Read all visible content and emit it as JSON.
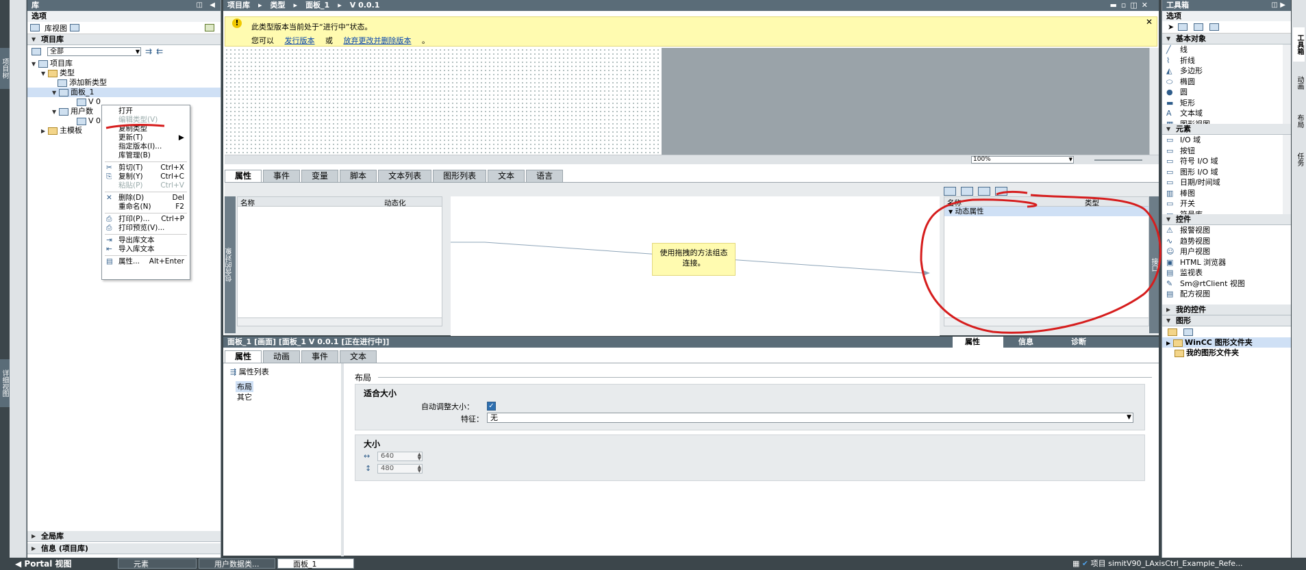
{
  "window": {
    "left_strip_top": "项目树",
    "left_strip_bottom": "详细视图"
  },
  "library": {
    "title": "库",
    "options_label": "选项",
    "lib_view_btn": "库视图",
    "project_library": "项目库",
    "filter": "全部",
    "tree": [
      "项目库",
      "类型",
      "添加新类型",
      "面板_1",
      "V 0",
      "用户数",
      "V 0",
      "主模板"
    ],
    "global_library": "全局库",
    "info": "信息 (项目库)"
  },
  "context_menu": [
    {
      "label": "打开",
      "shortcut": "",
      "icon": ""
    },
    {
      "label": "编辑类型(V)",
      "shortcut": "",
      "icon": "",
      "disabled": true
    },
    {
      "label": "复制类型",
      "shortcut": "",
      "icon": ""
    },
    {
      "label": "更新(T)",
      "shortcut": "▶",
      "icon": ""
    },
    {
      "label": "指定版本(I)...",
      "shortcut": "",
      "icon": ""
    },
    {
      "label": "库管理(B)",
      "shortcut": "",
      "icon": ""
    },
    {
      "sep": true
    },
    {
      "label": "剪切(T)",
      "shortcut": "Ctrl+X",
      "icon": "✂"
    },
    {
      "label": "复制(Y)",
      "shortcut": "Ctrl+C",
      "icon": "⎘"
    },
    {
      "label": "粘贴(P)",
      "shortcut": "Ctrl+V",
      "icon": "",
      "disabled": true
    },
    {
      "sep": true
    },
    {
      "label": "删除(D)",
      "shortcut": "Del",
      "icon": "✕"
    },
    {
      "label": "重命名(N)",
      "shortcut": "F2",
      "icon": ""
    },
    {
      "sep": true
    },
    {
      "label": "打印(P)...",
      "shortcut": "Ctrl+P",
      "icon": "⎙"
    },
    {
      "label": "打印预览(V)...",
      "shortcut": "",
      "icon": "⎙"
    },
    {
      "sep": true
    },
    {
      "label": "导出库文本",
      "shortcut": "",
      "icon": "⇥"
    },
    {
      "label": "导入库文本",
      "shortcut": "",
      "icon": "⇤"
    },
    {
      "sep": true
    },
    {
      "label": "属性...",
      "shortcut": "Alt+Enter",
      "icon": "▤"
    }
  ],
  "editor": {
    "breadcrumb": [
      "项目库",
      "类型",
      "面板_1",
      "V 0.0.1"
    ],
    "banner_line1": "此类型版本当前处于“进行中”状态。",
    "banner_prefix": "您可以",
    "banner_link1": "发行版本",
    "banner_or": "或",
    "banner_link2": "放弃更改并删除版本",
    "banner_suffix": "。",
    "zoom": "100%",
    "tabs": [
      "属性",
      "事件",
      "变量",
      "脚本",
      "文本列表",
      "图形列表",
      "文本",
      "语言"
    ],
    "left_grid_headers": [
      "名称",
      "动态化"
    ],
    "side_left": "包含的对象",
    "side_right": "接口",
    "hint": "使用拖拽的方法组态连接。",
    "right_grid_headers": [
      "名称",
      "类型"
    ],
    "dyn_prop": "动态属性"
  },
  "inspector": {
    "title": "面板_1 [画面] [面板_1 V 0.0.1 [正在进行中]]",
    "top_tabs": [
      "属性",
      "信息",
      "诊断"
    ],
    "tabs": [
      "属性",
      "动画",
      "事件",
      "文本"
    ],
    "prop_list": "属性列表",
    "nav": [
      "布局",
      "其它"
    ],
    "section": "布局",
    "fit_group": "适合大小",
    "auto_size_label": "自动调整大小：",
    "feature_label": "特征：",
    "feature_value": "无",
    "size_group": "大小",
    "width": "640",
    "height": "480"
  },
  "toolbox": {
    "title": "工具箱",
    "options_label": "选项",
    "basic_title": "基本对象",
    "basic": [
      "线",
      "折线",
      "多边形",
      "椭圆",
      "圆",
      "矩形",
      "文本域",
      "图形视图"
    ],
    "elements_title": "元素",
    "elements": [
      "I/O 域",
      "按钮",
      "符号 I/O 域",
      "图形 I/O 域",
      "日期/时间域",
      "棒图",
      "开关",
      "符号库"
    ],
    "controls_title": "控件",
    "controls": [
      "报警视图",
      "趋势视图",
      "用户视图",
      "HTML 浏览器",
      "监视表",
      "Sm@rtClient 视图",
      "配方视图"
    ],
    "my_controls": "我的控件",
    "graphics_title": "图形",
    "graphics": [
      "WinCC 图形文件夹",
      "我的图形文件夹"
    ],
    "right_strip": [
      "工具箱",
      "动画",
      "布局",
      "任务"
    ]
  },
  "taskbar": {
    "portal": "Portal 视图",
    "buttons": [
      "元素",
      "用户数据类...",
      "面板_1"
    ],
    "project": "项目 simitV90_LAxisCtrl_Example_Refe..."
  }
}
